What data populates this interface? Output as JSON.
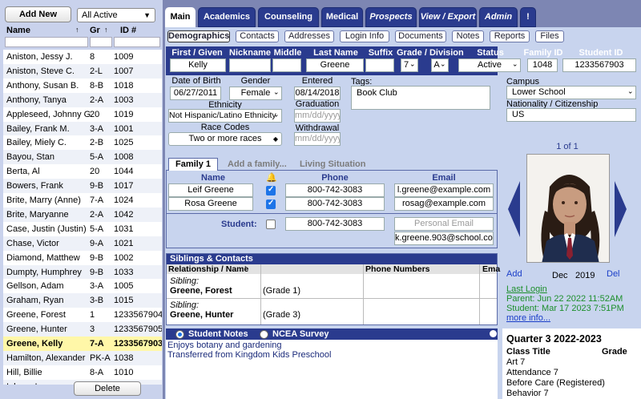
{
  "left": {
    "add_new": "Add New",
    "filter": "All Active",
    "headers": {
      "name": "Name",
      "gr": "Gr",
      "id": "ID #"
    },
    "students": [
      {
        "name": "Aniston, Jessy J.",
        "gr": "8",
        "id": "1009"
      },
      {
        "name": "Aniston, Steve C.",
        "gr": "2-L",
        "id": "1007"
      },
      {
        "name": "Anthony, Susan B.",
        "gr": "8-B",
        "id": "1018"
      },
      {
        "name": "Anthony, Tanya",
        "gr": "2-A",
        "id": "1003"
      },
      {
        "name": "Appleseed, Johnny G.",
        "gr": "20",
        "id": "1019"
      },
      {
        "name": "Bailey, Frank M.",
        "gr": "3-A",
        "id": "1001"
      },
      {
        "name": "Bailey, Miely C.",
        "gr": "2-B",
        "id": "1025"
      },
      {
        "name": "Bayou, Stan",
        "gr": "5-A",
        "id": "1008"
      },
      {
        "name": "Berta, Al",
        "gr": "20",
        "id": "1044"
      },
      {
        "name": "Bowers, Frank",
        "gr": "9-B",
        "id": "1017"
      },
      {
        "name": "Brite, Marry (Anne)",
        "gr": "7-A",
        "id": "1024"
      },
      {
        "name": "Brite, Maryanne",
        "gr": "2-A",
        "id": "1042"
      },
      {
        "name": "Case, Justin (Justin)",
        "gr": "5-A",
        "id": "1031"
      },
      {
        "name": "Chase, Victor",
        "gr": "9-A",
        "id": "1021"
      },
      {
        "name": "Diamond, Matthew",
        "gr": "9-B",
        "id": "1002"
      },
      {
        "name": "Dumpty, Humphrey",
        "gr": "9-B",
        "id": "1033"
      },
      {
        "name": "Gellson, Adam",
        "gr": "3-A",
        "id": "1005"
      },
      {
        "name": "Graham, Ryan",
        "gr": "3-B",
        "id": "1015"
      },
      {
        "name": "Greene, Forest",
        "gr": "1",
        "id": "1233567904"
      },
      {
        "name": "Greene, Hunter",
        "gr": "3",
        "id": "1233567905"
      },
      {
        "name": "Greene, Kelly",
        "gr": "7-A",
        "id": "1233567903"
      },
      {
        "name": "Hamilton, Alexander",
        "gr": "PK-A",
        "id": "1038"
      },
      {
        "name": "Hill, Billie",
        "gr": "8-A",
        "id": "1010"
      },
      {
        "name": "Inlove, Ima",
        "gr": "",
        "id": ""
      }
    ],
    "selected_index": 20,
    "delete": "Delete"
  },
  "tabs": [
    {
      "label": "Main",
      "active": true
    },
    {
      "label": "Academics"
    },
    {
      "label": "Counseling"
    },
    {
      "label": "Medical"
    },
    {
      "label": "Prospects",
      "italic": true
    },
    {
      "label": "View / Export",
      "italic": true
    },
    {
      "label": "Admin",
      "italic": true
    },
    {
      "label": "!"
    }
  ],
  "subtabs": [
    "Demographics",
    "Contacts",
    "Addresses",
    "Login Info",
    "Documents",
    "Notes",
    "Reports",
    "Files"
  ],
  "name_bar": {
    "first_label": "First / Given",
    "nick_label": "Nickname",
    "middle_label": "Middle",
    "last_label": "Last Name",
    "suffix_label": "Suffix",
    "grade_label": "Grade / Division",
    "status_label": "Status",
    "family_id_label": "Family ID",
    "student_id_label": "Student ID",
    "first": "Kelly",
    "nick": "",
    "middle": "",
    "last": "Greene",
    "suffix": "",
    "grade": "7",
    "division": "A",
    "status": "Active",
    "family_id": "1048",
    "student_id": "1233567903"
  },
  "demo": {
    "dob_label": "Date of Birth",
    "dob": "06/27/2011",
    "gender_label": "Gender",
    "gender": "Female",
    "entered_label": "Entered",
    "entered": "08/14/2018",
    "tags_label": "Tags:",
    "tags": "Book Club",
    "campus_label": "Campus",
    "campus": "Lower School",
    "ethnicity_label": "Ethnicity",
    "ethnicity": "Not Hispanic/Latino Ethnicity",
    "graduation_label": "Graduation",
    "graduation_ph": "mm/dd/yyyy",
    "nationality_label": "Nationality / Citizenship",
    "nationality": "US",
    "race_label": "Race Codes",
    "race": "Two or more races",
    "withdrawal_label": "Withdrawal",
    "withdrawal_ph": "mm/dd/yyyy"
  },
  "family": {
    "tab": "Family 1",
    "add": "Add a family...",
    "living": "Living Situation",
    "name_h": "Name",
    "phone_h": "Phone",
    "email_h": "Email",
    "members": [
      {
        "name": "Leif Greene",
        "phone": "800-742-3083",
        "email": "l.greene@example.com",
        "checked": true
      },
      {
        "name": "Rosa Greene",
        "phone": "800-742-3083",
        "email": "rosag@example.com",
        "checked": true
      }
    ],
    "student_label": "Student:",
    "student_phone": "800-742-3083",
    "personal_email_ph": "Personal Email",
    "school_email": "k.greene.903@school.com"
  },
  "siblings": {
    "title": "Siblings & Contacts",
    "col_rel": "Relationship / Name",
    "col_phone": "Phone Numbers",
    "col_email": "Ema",
    "rows": [
      {
        "rel": "Sibling:",
        "name": "Greene, Forest",
        "grade": "(Grade 1)"
      },
      {
        "rel": "Sibling:",
        "name": "Greene, Hunter",
        "grade": "(Grade 3)"
      }
    ]
  },
  "notes": {
    "opt1": "Student Notes",
    "opt2": "NCEA Survey",
    "lines": [
      "Enjoys botany and gardening",
      "Transferred from Kingdom Kids Preschool"
    ]
  },
  "photo": {
    "counter": "1 of 1",
    "add": "Add",
    "month": "Dec",
    "year": "2019",
    "del": "Del"
  },
  "login": {
    "title": "Last Login",
    "parent": "Parent: Jun 22 2022 11:52AM",
    "student": "Student: Mar 17 2023 7:51PM",
    "more": "more info..."
  },
  "quarter": {
    "title": "Quarter 3 2022-2023",
    "col_class": "Class Title",
    "col_grade": "Grade",
    "classes": [
      "Art 7",
      "Attendance 7",
      "Before Care (Registered)",
      "Behavior 7"
    ]
  },
  "colors": {
    "navy": "#2a3b8e",
    "panel": "#c8d4ee",
    "checkbox": "#1d74e8",
    "selected_row": "#fff7a8"
  }
}
